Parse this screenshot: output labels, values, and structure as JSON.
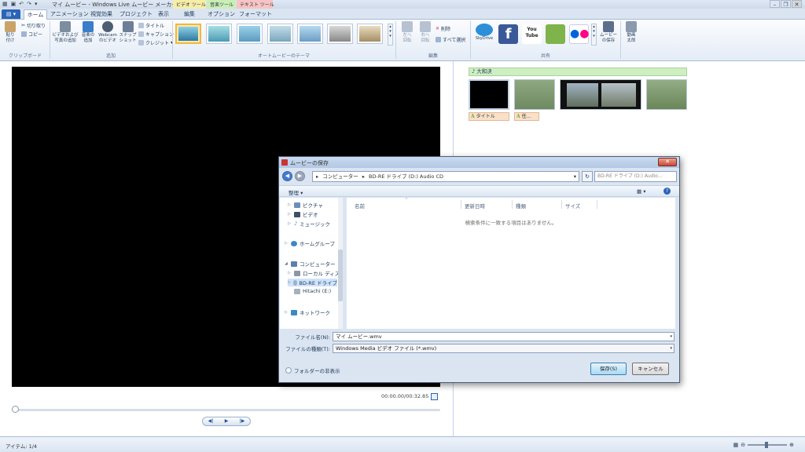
{
  "window": {
    "title": "マイ ムービー - Windows Live ムービー メーカー",
    "context_tabs": [
      "ビデオ ツール",
      "音楽ツール",
      "テキスト ツール"
    ]
  },
  "tabs": [
    {
      "label": "ホーム",
      "active": true
    },
    {
      "label": "アニメーション"
    },
    {
      "label": "視覚効果"
    },
    {
      "label": "プロジェクト"
    },
    {
      "label": "表示"
    },
    {
      "label": "編集"
    },
    {
      "label": "オプション"
    },
    {
      "label": "フォーマット"
    }
  ],
  "ribbon": {
    "clipboard": {
      "label": "クリップボード",
      "paste": "貼り\n付け",
      "cut": "切り取り",
      "copy": "コピー"
    },
    "add": {
      "label": "追加",
      "add_video": "ビデオおよび\n写真の追加",
      "add_music": "音楽の\n追加",
      "webcam": "Webcam\nのビデオ",
      "snapshot": "スナップ\nショット",
      "title": "タイトル",
      "caption": "キャプション",
      "credits": "クレジット"
    },
    "themes": {
      "label": "オートムービーのテーマ"
    },
    "edit": {
      "label": "編集",
      "rotate_left": "左へ\n回転",
      "rotate_right": "右へ\n回転",
      "delete": "削除",
      "select_all": "すべて選択"
    },
    "share": {
      "label": "共有",
      "skydrive": "SkyDrive",
      "youtube": "You\nTube",
      "save_movie": "ムービー\nの保存",
      "sign_in": "動画\n太郎"
    }
  },
  "colors": {
    "accent": "#2a64b8",
    "ribbon_bg": "#e4ecf6",
    "music_track": "#cfeec2",
    "caption_track": "#f9e0c9"
  },
  "preview": {
    "time": "00:00.00/00:32.85"
  },
  "storyboard": {
    "music_label": "大和決",
    "captions": [
      "タイトル",
      "任..."
    ]
  },
  "status": {
    "items": "アイテム: 1/4"
  },
  "dialog": {
    "title": "ムービーの保存",
    "breadcrumb": [
      "コンピューター",
      "BD-RE ドライブ (D:) Audio CD"
    ],
    "search_placeholder": "BD-RE ドライブ (D:) Audio...",
    "organize": "整理 ▾",
    "nav": [
      {
        "label": "ピクチャ",
        "icon": "pictures-icon",
        "level": 1
      },
      {
        "label": "ビデオ",
        "icon": "videos-icon",
        "level": 1
      },
      {
        "label": "ミュージック",
        "icon": "music-icon",
        "level": 1
      },
      {
        "label": "ホームグループ",
        "icon": "homegroup-icon",
        "level": 0
      },
      {
        "label": "コンピューター",
        "icon": "computer-icon",
        "level": 0
      },
      {
        "label": "ローカル ディス",
        "icon": "local-disk-icon",
        "level": 1
      },
      {
        "label": "BD-RE ドライブ",
        "icon": "bd-drive-icon",
        "level": 1,
        "selected": true
      },
      {
        "label": "Hitachi (E:)",
        "icon": "usb-drive-icon",
        "level": 1
      },
      {
        "label": "ネットワーク",
        "icon": "network-icon",
        "level": 0
      }
    ],
    "columns": [
      "名前",
      "更新日時",
      "種類",
      "サイズ"
    ],
    "empty_message": "検索条件に一致する項目はありません。",
    "filename_label": "ファイル名(N):",
    "filename_value": "マイ ムービー.wmv",
    "filetype_label": "ファイルの種類(T):",
    "filetype_value": "Windows Media ビデオ ファイル (*.wmv)",
    "hide_folders": "フォルダーの非表示",
    "save": "保存(S)",
    "cancel": "キャンセル"
  }
}
